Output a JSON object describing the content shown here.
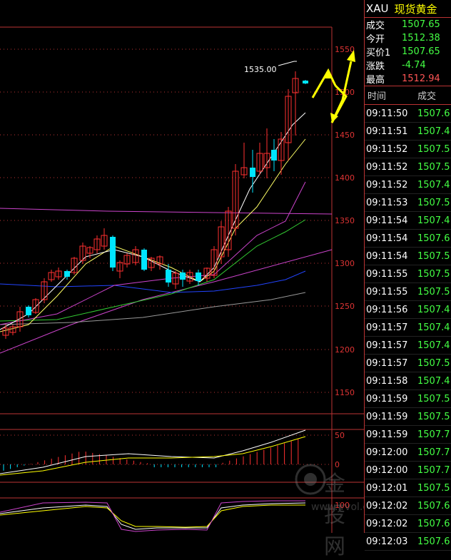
{
  "header": {
    "symbol": "XAU",
    "name": "现货黄金"
  },
  "quote": [
    {
      "label": "成交",
      "value": "1507.65",
      "color": "green"
    },
    {
      "label": "今开",
      "value": "1512.38",
      "color": "green"
    },
    {
      "label": "买价1",
      "value": "1507.65",
      "color": "green"
    },
    {
      "label": "涨跌",
      "value": "-4.74",
      "color": "green"
    },
    {
      "label": "最高",
      "value": "1512.94",
      "color": "red"
    }
  ],
  "ticks_header": {
    "time": "时间",
    "deal": "成交"
  },
  "ticks": [
    {
      "time": "09:11:50",
      "price": "1507.6"
    },
    {
      "time": "09:11:51",
      "price": "1507.4"
    },
    {
      "time": "09:11:52",
      "price": "1507.5"
    },
    {
      "time": "09:11:52",
      "price": "1507.5"
    },
    {
      "time": "09:11:52",
      "price": "1507.4"
    },
    {
      "time": "09:11:53",
      "price": "1507.5"
    },
    {
      "time": "09:11:54",
      "price": "1507.4"
    },
    {
      "time": "09:11:54",
      "price": "1507.6"
    },
    {
      "time": "09:11:54",
      "price": "1507.5"
    },
    {
      "time": "09:11:55",
      "price": "1507.5"
    },
    {
      "time": "09:11:55",
      "price": "1507.5"
    },
    {
      "time": "09:11:56",
      "price": "1507.4"
    },
    {
      "time": "09:11:57",
      "price": "1507.4"
    },
    {
      "time": "09:11:57",
      "price": "1507.4"
    },
    {
      "time": "09:11:57",
      "price": "1507.5"
    },
    {
      "time": "09:11:58",
      "price": "1507.4"
    },
    {
      "time": "09:11:59",
      "price": "1507.5"
    },
    {
      "time": "09:11:59",
      "price": "1507.5"
    },
    {
      "time": "09:11:59",
      "price": "1507.7"
    },
    {
      "time": "09:12:00",
      "price": "1507.7"
    },
    {
      "time": "09:12:00",
      "price": "1507.7"
    },
    {
      "time": "09:12:01",
      "price": "1507.5"
    },
    {
      "time": "09:12:02",
      "price": "1507.6"
    },
    {
      "time": "09:12:02",
      "price": "1507.6"
    },
    {
      "time": "09:12:03",
      "price": "1507.6"
    }
  ],
  "chart": {
    "price_labels": [
      "1550",
      "1500",
      "1450",
      "1400",
      "1350",
      "1300",
      "1250",
      "1200",
      "1150"
    ],
    "macd_labels": [
      "50",
      "0"
    ],
    "kdj_labels": [
      "100"
    ],
    "high_annotation": "1535.00"
  },
  "watermark": {
    "brand": "金投网",
    "url": "www.jrvol.com"
  },
  "colors": {
    "up": "#ff3030",
    "down": "#00e5ff",
    "green": "#44ff44",
    "axis": "#dd3333",
    "arrow": "#ffff00"
  }
}
